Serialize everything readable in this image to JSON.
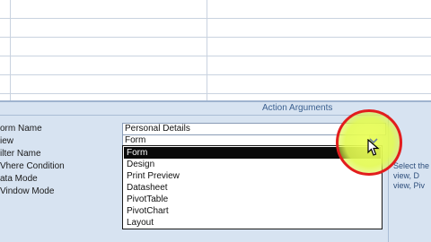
{
  "pane": {
    "header_title": "Action Arguments"
  },
  "arguments": [
    {
      "label": "orm Name",
      "value": "Personal Details"
    },
    {
      "label": "iew",
      "value": "Form"
    },
    {
      "label": "ilter Name",
      "value": ""
    },
    {
      "label": "Vhere Condition",
      "value": ""
    },
    {
      "label": "ata Mode",
      "value": ""
    },
    {
      "label": "Vindow Mode",
      "value": ""
    }
  ],
  "dropdown": {
    "selected": "Form",
    "options": [
      "Form",
      "Design",
      "Print Preview",
      "Datasheet",
      "PivotTable",
      "PivotChart",
      "Layout"
    ]
  },
  "help_text": {
    "line1": "Select the",
    "line2": "view, D",
    "line3": "view, Piv"
  },
  "icons": {
    "dropdown_arrow": "chevron-down-icon",
    "cursor": "mouse-pointer-icon"
  },
  "colors": {
    "pane_bg": "#d7e3f1",
    "header_text": "#3a5f8f",
    "highlight_ring": "#e21d1d",
    "highlight_fill": "#ecff5a",
    "selected_option": "#0a0a0a"
  }
}
